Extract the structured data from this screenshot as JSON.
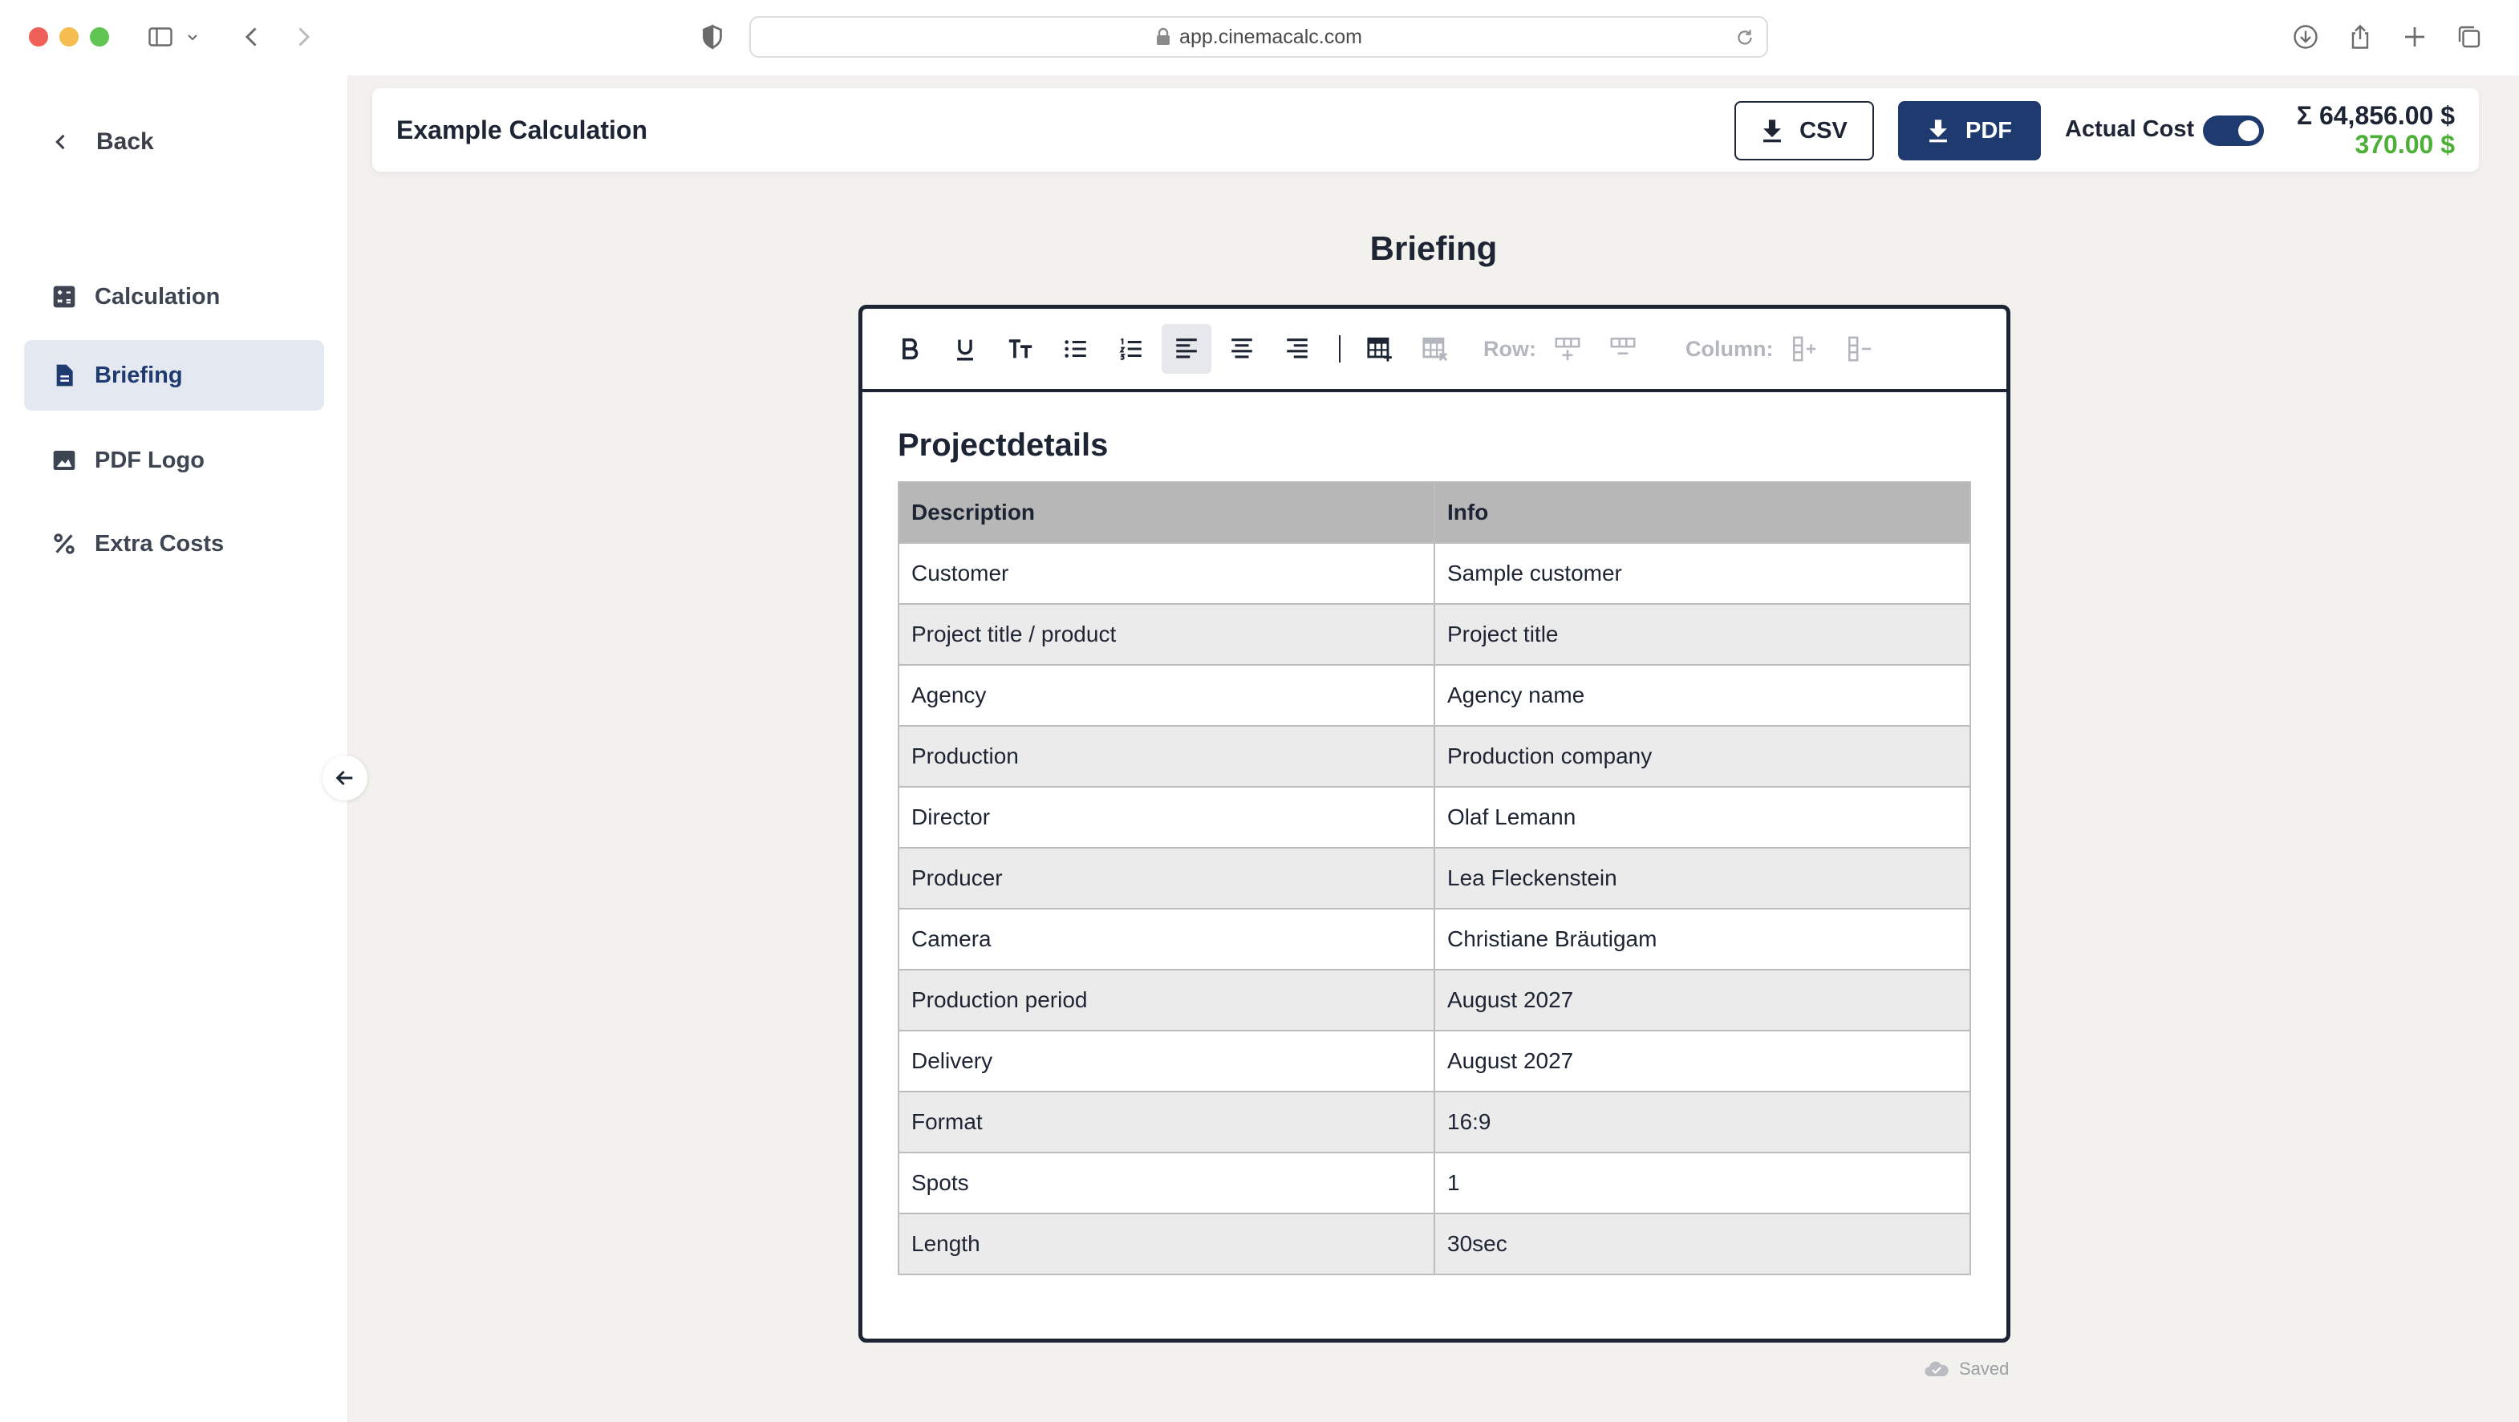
{
  "browser": {
    "url": "app.cinemacalc.com",
    "traffic_colors": [
      "#ee5f57",
      "#f5bd4f",
      "#61c554"
    ]
  },
  "sidebar": {
    "back_label": "Back",
    "items": [
      {
        "label": "Calculation",
        "icon": "calculator-icon",
        "active": false
      },
      {
        "label": "Briefing",
        "icon": "document-icon",
        "active": true
      },
      {
        "label": "PDF Logo",
        "icon": "image-icon",
        "active": false
      },
      {
        "label": "Extra Costs",
        "icon": "percent-icon",
        "active": false
      }
    ]
  },
  "header": {
    "title": "Example Calculation",
    "csv_label": "CSV",
    "pdf_label": "PDF",
    "actual_cost_label": "Actual Cost",
    "actual_cost_enabled": true,
    "total": "Σ 64,856.00 $",
    "actual_total": "370.00 $",
    "accent_color": "#1f3a6e",
    "positive_color": "#4caf36"
  },
  "page": {
    "heading": "Briefing"
  },
  "toolbar": {
    "row_label": "Row:",
    "column_label": "Column:"
  },
  "document": {
    "section_title": "Projectdetails",
    "columns": [
      "Description",
      "Info"
    ],
    "rows": [
      [
        "Customer",
        "Sample customer"
      ],
      [
        "Project title / product",
        "Project title"
      ],
      [
        "Agency",
        "Agency name"
      ],
      [
        "Production",
        "Production company"
      ],
      [
        "Director",
        "Olaf Lemann"
      ],
      [
        "Producer",
        "Lea Fleckenstein"
      ],
      [
        "Camera",
        "Christiane Bräutigam"
      ],
      [
        "Production period",
        "August 2027"
      ],
      [
        "Delivery",
        "August 2027"
      ],
      [
        "Format",
        "16:9"
      ],
      [
        "Spots",
        "1"
      ],
      [
        "Length",
        "30sec"
      ]
    ]
  },
  "status": {
    "saved_label": "Saved"
  }
}
